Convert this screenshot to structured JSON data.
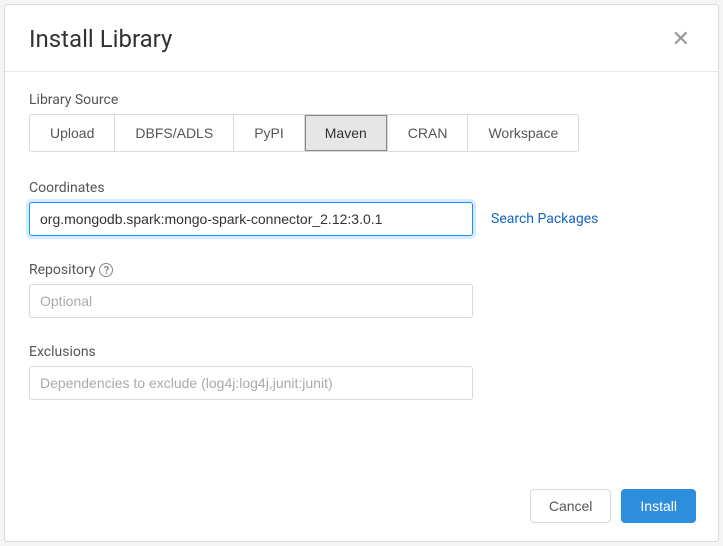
{
  "header": {
    "title": "Install Library"
  },
  "librarySource": {
    "label": "Library Source",
    "options": [
      "Upload",
      "DBFS/ADLS",
      "PyPI",
      "Maven",
      "CRAN",
      "Workspace"
    ],
    "active": "Maven"
  },
  "coordinates": {
    "label": "Coordinates",
    "value": "org.mongodb.spark:mongo-spark-connector_2.12:3.0.1",
    "searchLink": "Search Packages"
  },
  "repository": {
    "label": "Repository",
    "placeholder": "Optional"
  },
  "exclusions": {
    "label": "Exclusions",
    "placeholder": "Dependencies to exclude (log4j:log4j,junit:junit)"
  },
  "footer": {
    "cancel": "Cancel",
    "install": "Install"
  }
}
